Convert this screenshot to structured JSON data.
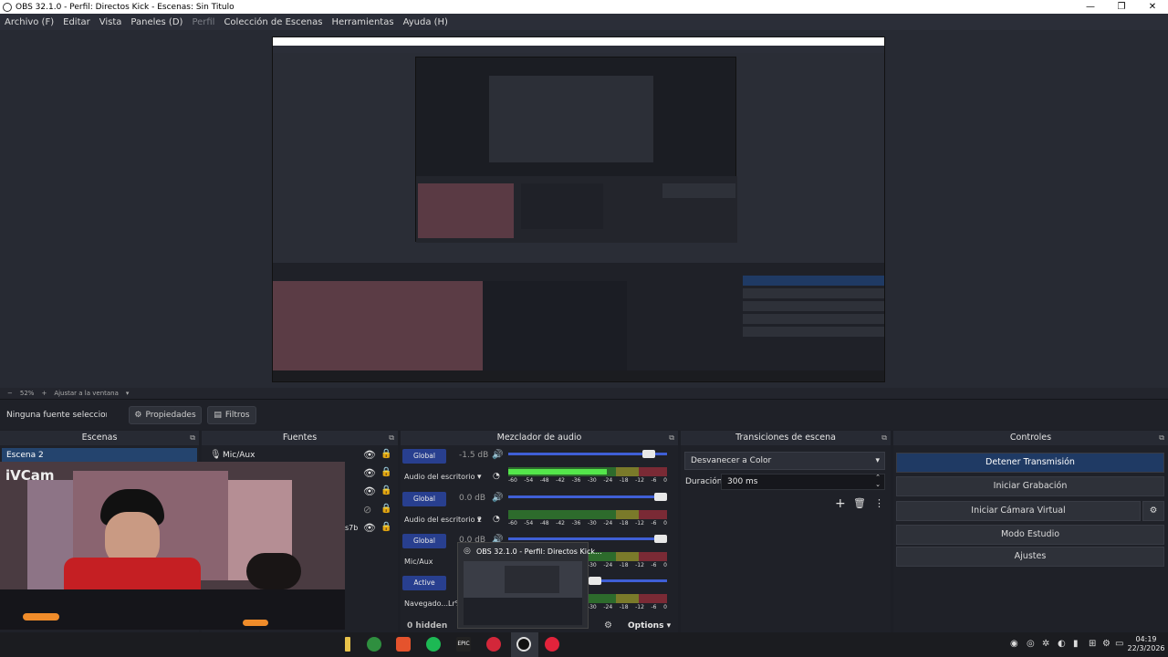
{
  "window": {
    "title": "OBS 32.1.0 - Perfil: Directos Kick - Escenas: Sin Titulo"
  },
  "menu": [
    "Archivo (F)",
    "Editar",
    "Vista",
    "Paneles (D)",
    "Perfil",
    "Colección de Escenas",
    "Herramientas",
    "Ayuda (H)"
  ],
  "zoom": {
    "minus": "−",
    "value": "52%",
    "plus": "+",
    "fit": "Ajustar a la ventana"
  },
  "properties_bar": {
    "no_source": "Ninguna fuente seleccionada",
    "properties": "Propiedades",
    "filters": "Filtros"
  },
  "docks": {
    "scenes": {
      "title": "Escenas",
      "items": [
        "Escena 2"
      ]
    },
    "sources": {
      "title": "Fuentes",
      "items": [
        "Mic/Aux",
        "",
        "",
        "",
        "s7b"
      ]
    },
    "mixer": {
      "title": "Mezclador de audio",
      "channels": [
        {
          "badge": "Global",
          "db": "-1.5 dB",
          "name": "Audio del escritorio",
          "level": 0.92,
          "meter": 0.62
        },
        {
          "badge": "Global",
          "db": "0.0 dB",
          "name": "Audio del escritorio 2",
          "level": 1.0,
          "meter": 0
        },
        {
          "badge": "Global",
          "db": "0.0 dB",
          "name": "Mic/Aux",
          "level": 1.0,
          "meter": 0
        },
        {
          "badge": "Active",
          "db": "",
          "name": "Navegado...Lr%2I",
          "level": 0.55,
          "meter": 0
        }
      ],
      "ticks": [
        "-60",
        "-54",
        "-48",
        "-42",
        "-36",
        "-30",
        "-24",
        "-18",
        "-12",
        "-6",
        "0"
      ],
      "hidden": "0 hidden",
      "options": "Options"
    },
    "transitions": {
      "title": "Transiciones de escena",
      "selected": "Desvanecer a Color",
      "duration_label": "Duración",
      "duration_value": "300 ms"
    },
    "controls": {
      "title": "Controles",
      "stop_stream": "Detener Transmisión",
      "start_record": "Iniciar Grabación",
      "virtual_cam": "Iniciar Cámara Virtual",
      "studio": "Modo Estudio",
      "settings": "Ajustes"
    }
  },
  "webcam": {
    "label": "iVCam"
  },
  "popup": {
    "title": "OBS 32.1.0 - Perfil: Directos Kick..."
  },
  "taskbar": {
    "time": "04:19",
    "date": "22/3/2026",
    "epic_label": "EPIC"
  },
  "colors": {
    "accent": "#283f8f",
    "active_control": "#1f3a64",
    "meter_green": "#54e64b"
  }
}
